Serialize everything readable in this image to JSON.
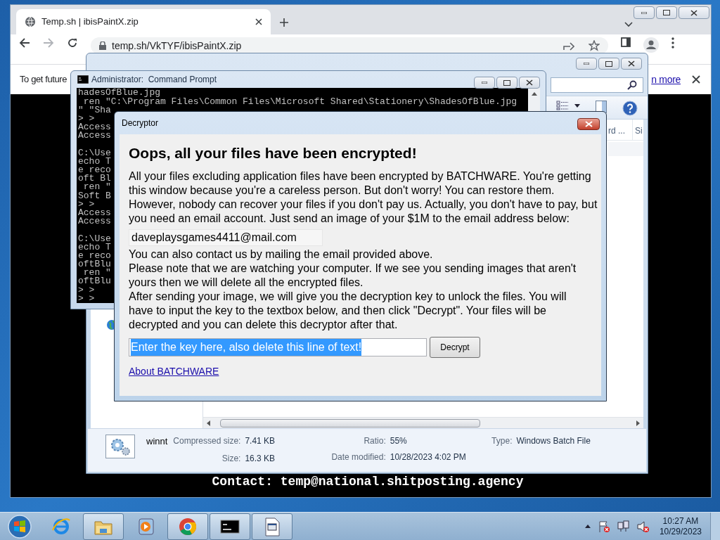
{
  "browser": {
    "tab": {
      "title": "Temp.sh | ibisPaintX.zip"
    },
    "address": "temp.sh/VkTYF/ibisPaintX.zip",
    "info_bar": {
      "text": "To get future",
      "link": "n more"
    },
    "page": {
      "contact": "Contact: temp@national.shitposting.agency"
    }
  },
  "archive_window": {
    "columns": [
      "rd ...",
      "Si"
    ],
    "details": {
      "name": "winnt",
      "fields": [
        {
          "label": "Compressed size:",
          "value": "7.41 KB"
        },
        {
          "label": "Size:",
          "value": "16.3 KB"
        },
        {
          "label": "Ratio:",
          "value": "55%"
        },
        {
          "label": "Date modified:",
          "value": "10/28/2023 4:02 PM"
        },
        {
          "label": "Type:",
          "value": "Windows Batch File"
        }
      ]
    }
  },
  "console": {
    "title": "Administrator:  Command Prompt",
    "blocks": [
      [
        "hadesOfBlue.jpg",
        " ren \"C:\\Program Files\\Common Files\\Microsoft Shared\\Stationery\\ShadesOfBlue.jpg",
        "\" \"Sha",
        "> >",
        "Access",
        "Access"
      ],
      [
        "C:\\Use",
        "echo T",
        "e reco",
        "oft Bl",
        " ren \"",
        "Soft B",
        "> >",
        "Access",
        "Access"
      ],
      [
        "C:\\Use",
        "echo T",
        "e reco",
        "oftBlu",
        " ren \"",
        "oftBlu",
        "> >",
        "> >"
      ]
    ]
  },
  "dialog": {
    "title": "Decryptor",
    "heading": "Oops, all your files have been encrypted!",
    "message": "All your files excluding application files have been encrypted by BATCHWARE. You're getting this window because you're a careless person. But don't worry! You can restore them. However, nobody can recover your files if you don't pay us. Actually, you don't have to pay, but you need an email account. Just send an image of your $1M to the email address below:",
    "email": "daveplaysgames4411@mail.com",
    "notes": [
      "You can also contact us by mailing the email provided above.",
      "Please note that we are watching your computer. If we see you sending images that aren't yours then we will delete all the encrypted files.",
      "After sending your image, we will give you the decryption key to unlock the files. You will have to input the key to the textbox below, and then click \"Decrypt\". Your files will be decrypted and you can delete this decryptor after that."
    ],
    "key_field": {
      "value": "Enter the key here, also delete this line of text!",
      "selected": true
    },
    "button": "Decrypt",
    "link": "About BATCHWARE"
  },
  "taskbar": {
    "items": [
      {
        "kind": "browser-e",
        "active": false
      },
      {
        "kind": "folder",
        "active": true
      },
      {
        "kind": "media",
        "active": false
      },
      {
        "kind": "chrome",
        "active": true
      },
      {
        "kind": "console",
        "active": true
      },
      {
        "kind": "batch",
        "active": true
      }
    ],
    "clock": {
      "time": "10:27 AM",
      "date": "10/29/2023"
    }
  }
}
